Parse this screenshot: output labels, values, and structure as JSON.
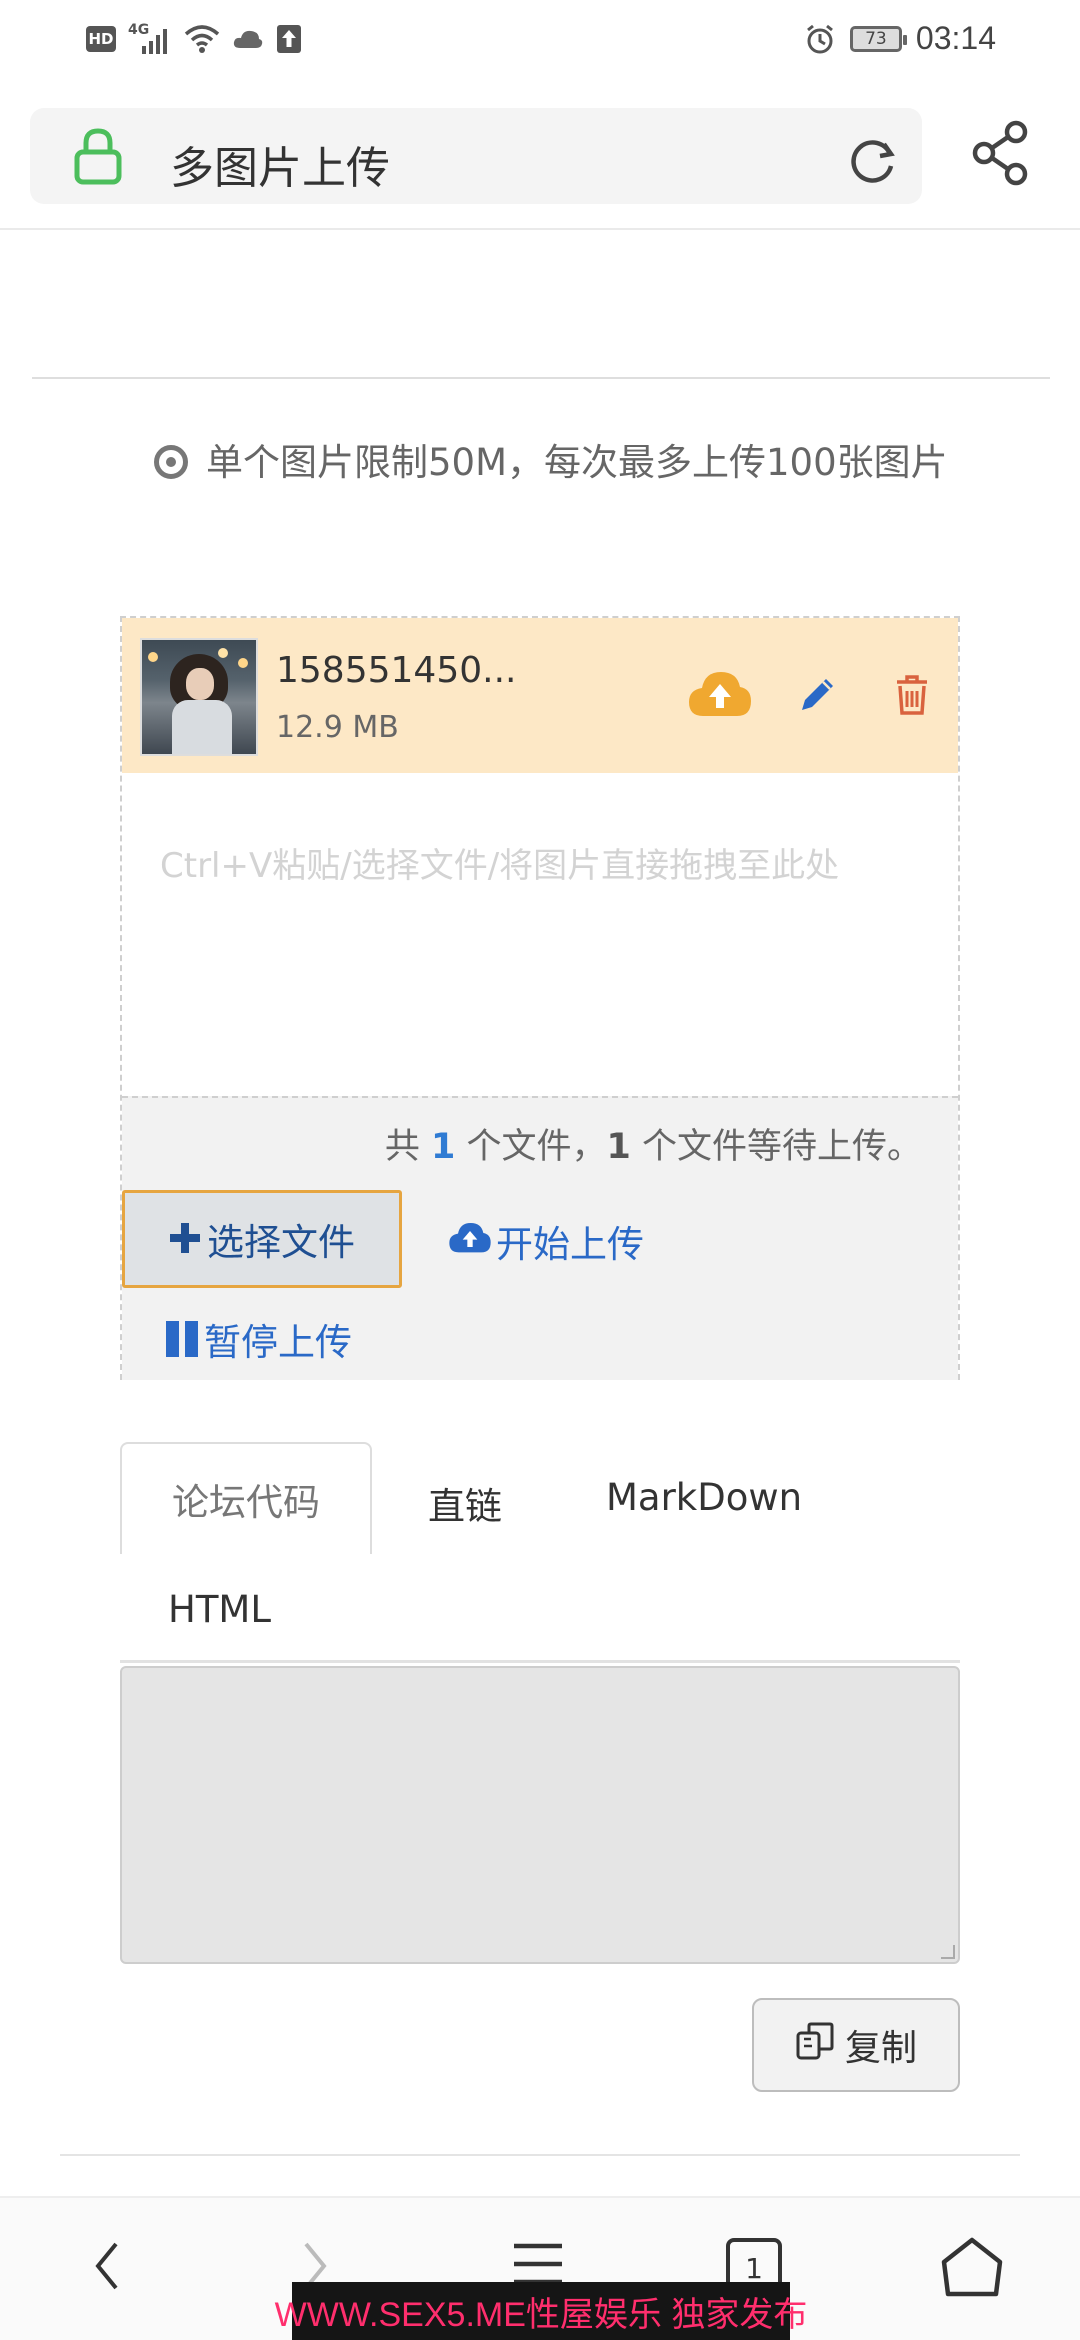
{
  "status_bar": {
    "hd": "HD",
    "network": "4G",
    "battery": "73",
    "time": "03:14"
  },
  "browser": {
    "title": "多图片上传"
  },
  "notice": "单个图片限制50M，每次最多上传100张图片",
  "uploader": {
    "file": {
      "name": "158551450...",
      "size": "12.9 MB"
    },
    "drop_hint": "Ctrl+V粘贴/选择文件/将图片直接拖拽至此处",
    "count": {
      "prefix": "共",
      "total": "1",
      "mid": "个文件，",
      "pending": "1",
      "suffix": "个文件等待上传。"
    },
    "select_label": "选择文件",
    "start_label": "开始上传",
    "pause_label": "暂停上传"
  },
  "tabs": {
    "forum": "论坛代码",
    "link": "直链",
    "markdown": "MarkDown",
    "html": "HTML"
  },
  "copy_label": "复制",
  "nav": {
    "tab_count": "1"
  },
  "watermark": "WWW.SEX5.ME性屋娱乐 独家发布",
  "colors": {
    "accent_blue": "#2a69c7",
    "upload_orange": "#f0a830",
    "delete_red": "#d9623e",
    "file_row_bg": "#fde8c6",
    "lock_green": "#4cbe5c"
  }
}
